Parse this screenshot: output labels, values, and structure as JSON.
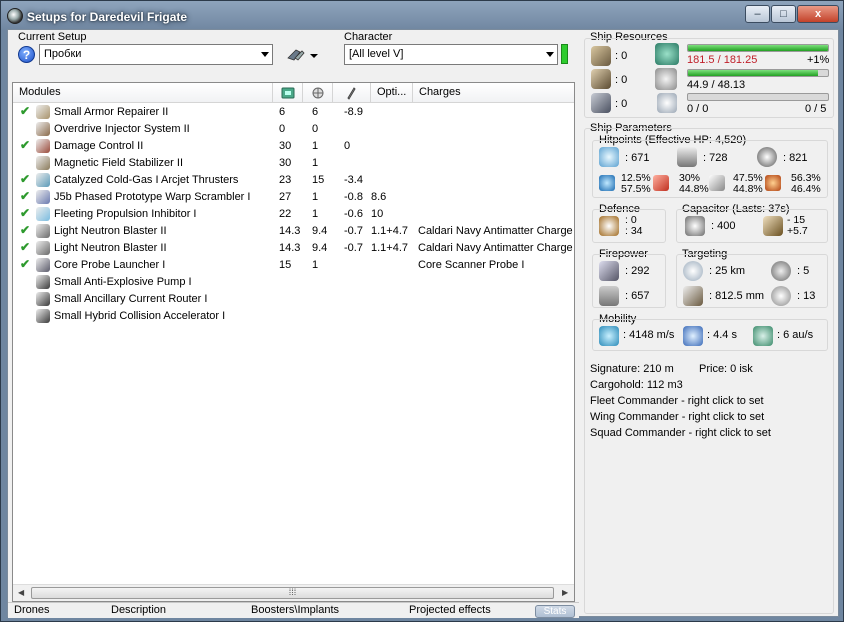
{
  "window": {
    "title": "Setups for Daredevil Frigate",
    "minimize": "–",
    "maximize": "□",
    "close": "x"
  },
  "setup": {
    "label": "Current Setup",
    "value": "Пробки",
    "help": "?"
  },
  "character": {
    "label": "Character",
    "value": "[All level V]"
  },
  "modules": {
    "headers": [
      "Modules",
      "",
      "",
      "",
      "Opti...",
      "Charges"
    ],
    "rows": [
      {
        "active": true,
        "name": "Small Armor Repairer II",
        "c1": "6",
        "c2": "6",
        "c3": "-8.9",
        "opt": "",
        "charge": "",
        "icon": "armor-repairer-icon",
        "color": "#a8926a"
      },
      {
        "active": false,
        "name": "Overdrive Injector System II",
        "c1": "0",
        "c2": "0",
        "c3": "",
        "opt": "",
        "charge": "",
        "icon": "overdrive-icon",
        "color": "#8a6a4a"
      },
      {
        "active": true,
        "name": "Damage Control II",
        "c1": "30",
        "c2": "1",
        "c3": "0",
        "opt": "",
        "charge": "",
        "icon": "damage-control-icon",
        "color": "#9a4a3a"
      },
      {
        "active": false,
        "name": "Magnetic Field Stabilizer II",
        "c1": "30",
        "c2": "1",
        "c3": "",
        "opt": "",
        "charge": "",
        "icon": "magnetic-stabilizer-icon",
        "color": "#8a7a5a"
      },
      {
        "active": true,
        "name": "Catalyzed Cold-Gas I Arcjet Thrusters",
        "c1": "23",
        "c2": "15",
        "c3": "-3.4",
        "opt": "",
        "charge": "",
        "icon": "afterburner-icon",
        "color": "#5a9ab8"
      },
      {
        "active": true,
        "name": "J5b Phased Prototype Warp Scrambler I",
        "c1": "27",
        "c2": "1",
        "c3": "-0.8",
        "opt": "8.6",
        "charge": "",
        "icon": "warp-scrambler-icon",
        "color": "#6a7ab0"
      },
      {
        "active": true,
        "name": "Fleeting Propulsion Inhibitor I",
        "c1": "22",
        "c2": "1",
        "c3": "-0.6",
        "opt": "10",
        "charge": "",
        "icon": "web-icon",
        "color": "#7abce0"
      },
      {
        "active": true,
        "name": "Light Neutron Blaster II",
        "c1": "14.3",
        "c2": "9.4",
        "c3": "-0.7",
        "opt": "1.1+4.7",
        "charge": "Caldari Navy Antimatter Charge S",
        "icon": "blaster-icon",
        "color": "#6a6a6a"
      },
      {
        "active": true,
        "name": "Light Neutron Blaster II",
        "c1": "14.3",
        "c2": "9.4",
        "c3": "-0.7",
        "opt": "1.1+4.7",
        "charge": "Caldari Navy Antimatter Charge S",
        "icon": "blaster-icon",
        "color": "#6a6a6a"
      },
      {
        "active": true,
        "name": "Core Probe Launcher I",
        "c1": "15",
        "c2": "1",
        "c3": "",
        "opt": "",
        "charge": "Core Scanner Probe I",
        "icon": "probe-launcher-icon",
        "color": "#5a5a6a"
      },
      {
        "active": false,
        "name": "Small Anti-Explosive Pump I",
        "c1": "",
        "c2": "",
        "c3": "",
        "opt": "",
        "charge": "",
        "icon": "rig-icon",
        "color": "#3a3a3a"
      },
      {
        "active": false,
        "name": "Small Ancillary Current Router I",
        "c1": "",
        "c2": "",
        "c3": "",
        "opt": "",
        "charge": "",
        "icon": "rig-icon",
        "color": "#3a3a3a"
      },
      {
        "active": false,
        "name": "Small Hybrid Collision Accelerator I",
        "c1": "",
        "c2": "",
        "c3": "",
        "opt": "",
        "charge": "",
        "icon": "rig-icon",
        "color": "#3a3a3a"
      }
    ]
  },
  "bottom_tabs": [
    "Drones",
    "Description",
    "Boosters\\Implants",
    "Projected effects",
    "Stats"
  ],
  "resources": {
    "label": "Ship Resources",
    "turret": ": 0",
    "launcher": ": 0",
    "drone": ": 0",
    "cpu": "181.5 / 181.25",
    "cpu_pct": "+1%",
    "cpu_fill": 1.0,
    "power": "44.9 / 48.13",
    "power_fill": 0.93,
    "calib_left": "0 / 0",
    "calib_right": "0 / 5",
    "calib_fill": 0.0
  },
  "params": {
    "label": "Ship Parameters",
    "hp_label": "Hitpoints (Effective HP: 4,520)",
    "shield": ": 671",
    "armor": ": 728",
    "hull": ": 821",
    "res_shield": [
      "12.5%",
      "57.5%"
    ],
    "res_armor": [
      "30%",
      "44.8%"
    ],
    "res_struct": [
      "47.5%",
      "44.8%"
    ],
    "res_hull": [
      "56.3%",
      "46.4%"
    ],
    "defence_label": "Defence",
    "defence": [
      ": 0",
      ": 34"
    ],
    "capacitor_label": "Capacitor (Lasts: 37s)",
    "cap_amount": ": 400",
    "cap_delta": [
      "- 15",
      "+5.7"
    ],
    "firepower_label": "Firepower",
    "dps": ": 292",
    "volley": ": 657",
    "targeting_label": "Targeting",
    "range": ": 25 km",
    "targets": ": 5",
    "scanres": ": 812.5 mm",
    "sensor": ": 13",
    "mobility_label": "Mobility",
    "speed": ": 4148 m/s",
    "align": ": 4.4 s",
    "warp": ": 6 au/s",
    "signature": "Signature: 210 m",
    "price": "Price: 0 isk",
    "cargohold": "Cargohold: 112 m3",
    "fleet": "Fleet Commander - right click to set",
    "wing": "Wing Commander - right click to set",
    "squad": "Squad Commander - right click to set"
  },
  "colors": {
    "cpu_text": "#c0202a",
    "bar_fill": "#22a022",
    "check": "#2e9a2e"
  }
}
